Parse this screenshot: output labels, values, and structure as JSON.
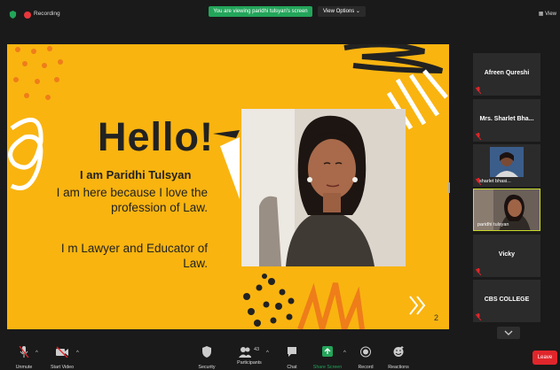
{
  "topbar": {
    "recording_label": "Recording",
    "viewing_banner": "You are viewing paridhi tulsyan's screen",
    "view_options": "View Options ⌄",
    "view_label": "View"
  },
  "slide": {
    "heading": "Hello!",
    "name_line": "I am Paridhi Tulsyan",
    "intro": "I am here because I love the profession of Law.",
    "role": "I m Lawyer and Educator of Law.",
    "page_number": "2",
    "colors": {
      "background": "#f9b410",
      "text": "#222222"
    }
  },
  "participants": [
    {
      "name": "Afreen Qureshi",
      "muted": true,
      "video": false
    },
    {
      "name": "Mrs. Sharlet Bha...",
      "muted": true,
      "video": false
    },
    {
      "name": "sharlet bhasi...",
      "muted": true,
      "video": true
    },
    {
      "name": "paridhi tulsyan",
      "muted": false,
      "video": true,
      "active": true
    },
    {
      "name": "Vicky",
      "muted": true,
      "video": false
    },
    {
      "name": "CBS COLLEGE",
      "muted": true,
      "video": false
    }
  ],
  "toolbar": {
    "unmute": "Unmute",
    "start_video": "Start Video",
    "security": "Security",
    "participants": "Participants",
    "participant_count": "43",
    "chat": "Chat",
    "share_screen": "Share Screen",
    "record": "Record",
    "reactions": "Reactions",
    "leave": "Leave"
  },
  "accent_colors": {
    "share_green": "#23a55a",
    "leave_red": "#e0262b",
    "active_border": "#c8d92a"
  }
}
